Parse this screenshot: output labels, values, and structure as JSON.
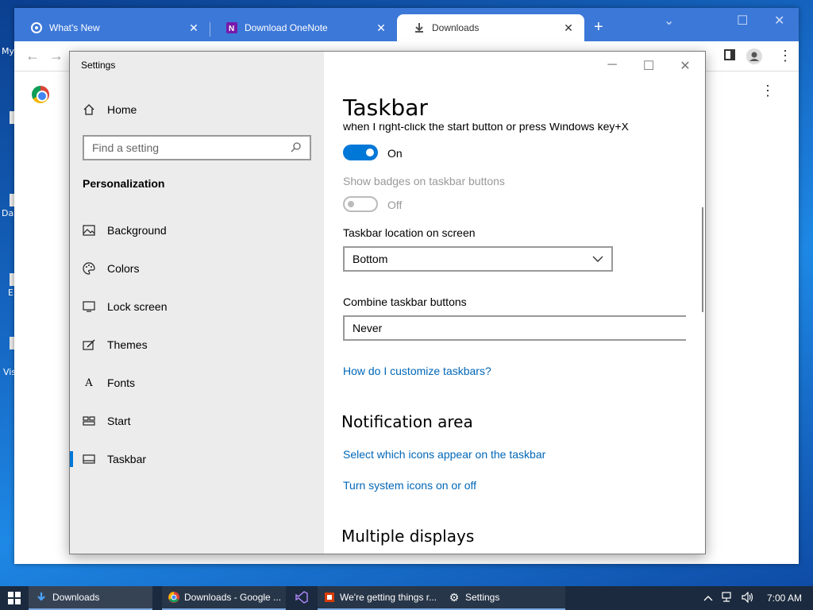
{
  "desktop": {
    "labels": [
      "My",
      "Da",
      "E",
      "Vis"
    ]
  },
  "chrome": {
    "tabs": [
      {
        "title": "What's New",
        "icon": "chrome-settings-icon"
      },
      {
        "title": "Download OneNote",
        "icon": "onenote-icon"
      },
      {
        "title": "Downloads",
        "icon": "download-icon"
      }
    ],
    "close_glyph": "✕",
    "new_tab_glyph": "+",
    "controls": {
      "minimize": "⌄",
      "maximize": "☐",
      "close": "✕"
    }
  },
  "settings": {
    "window_title": "Settings",
    "home_label": "Home",
    "search_placeholder": "Find a setting",
    "section": "Personalization",
    "nav": [
      {
        "label": "Background",
        "icon": "picture-icon"
      },
      {
        "label": "Colors",
        "icon": "palette-icon"
      },
      {
        "label": "Lock screen",
        "icon": "monitor-lock-icon"
      },
      {
        "label": "Themes",
        "icon": "brush-icon"
      },
      {
        "label": "Fonts",
        "icon": "font-icon"
      },
      {
        "label": "Start",
        "icon": "start-grid-icon"
      },
      {
        "label": "Taskbar",
        "icon": "taskbar-icon"
      }
    ],
    "selected_nav": "Taskbar",
    "content": {
      "title": "Taskbar",
      "clipped_text": "when I right-click the start button or press Windows key+X",
      "toggle1_state": "On",
      "badges_label": "Show badges on taskbar buttons",
      "toggle2_state": "Off",
      "location_label": "Taskbar location on screen",
      "location_value": "Bottom",
      "combine_label": "Combine taskbar buttons",
      "combine_value": "Never",
      "customize_link": "How do I customize taskbars?",
      "notification_header": "Notification area",
      "select_icons_link": "Select which icons appear on the taskbar",
      "system_icons_link": "Turn system icons on or off",
      "multiple_displays_header": "Multiple displays"
    }
  },
  "taskbar": {
    "items": [
      {
        "label": "Downloads",
        "icon": "download-arrow-icon"
      },
      {
        "label": "Downloads - Google ...",
        "icon": "chrome-icon"
      },
      {
        "label": "",
        "icon": "visual-studio-icon"
      },
      {
        "label": "We're getting things r...",
        "icon": "office-icon"
      },
      {
        "label": "Settings",
        "icon": "gear-icon"
      }
    ],
    "clock": "7:00 AM"
  },
  "colors": {
    "accent": "#0078d7",
    "link": "#0067b8",
    "tabstrip": "#3c78d8",
    "taskbar": "#1b2a3e"
  }
}
